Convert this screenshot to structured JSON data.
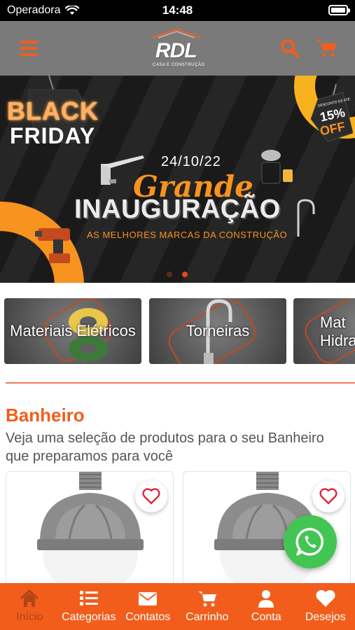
{
  "status_bar": {
    "carrier": "Operadora",
    "time": "14:48"
  },
  "header": {
    "logo_text": "RDL",
    "logo_subtitle": "CASA E CONSTRUÇÃO"
  },
  "banner": {
    "black": "BLACK",
    "friday": "FRIDAY",
    "discount_note": "DESCONTO DE ATÉ",
    "discount_percent": "15%",
    "discount_off": "OFF",
    "date": "24/10/22",
    "grande": "Grande",
    "inauguracao": "INAUGURAÇÃO",
    "marcas": "AS MELHORES MARCAS DA CONSTRUÇÃO",
    "slides_total": 2,
    "slide_active": 2
  },
  "categories": [
    {
      "label": "Materiais Elétricos"
    },
    {
      "label": "Torneiras"
    },
    {
      "label_line1": "Materiais",
      "label_line2": "Hidráulicos",
      "visible_line1": "Mat",
      "visible_line2": "Hidra"
    }
  ],
  "section": {
    "title": "Banheiro",
    "subtitle": "Veja uma seleção de produtos para o seu Banheiro que preparamos para você"
  },
  "bottom_nav": [
    {
      "label": "Início",
      "icon": "home-icon",
      "active": true
    },
    {
      "label": "Categorias",
      "icon": "list-icon",
      "active": false
    },
    {
      "label": "Contatos",
      "icon": "envelope-icon",
      "active": false
    },
    {
      "label": "Carrinho",
      "icon": "cart-icon",
      "active": false
    },
    {
      "label": "Conta",
      "icon": "user-icon",
      "active": false
    },
    {
      "label": "Desejos",
      "icon": "heart-icon",
      "active": false
    }
  ],
  "colors": {
    "brand_orange": "#f25d1c",
    "header_gray": "#7a7a7a",
    "whatsapp_green": "#43c553",
    "active_nav_label": "#b04518"
  }
}
